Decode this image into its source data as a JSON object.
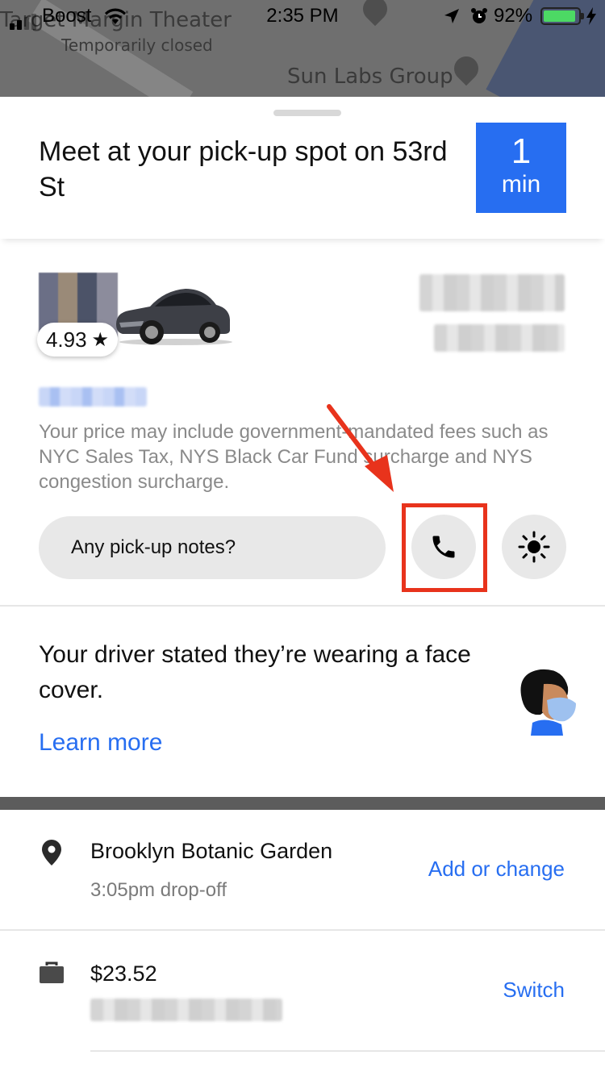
{
  "status_bar": {
    "carrier": "Boost",
    "time": "2:35 PM",
    "battery_percent": "92%",
    "battery_level": 0.92
  },
  "map": {
    "labels": [
      "Target Margin Theater",
      "Temporarily closed",
      "Sun Labs Group"
    ]
  },
  "trip_header": {
    "headline": "Meet at your pick-up spot on 53rd St",
    "eta_value": "1",
    "eta_unit": "min"
  },
  "driver": {
    "rating": "4.93"
  },
  "fees_notice": "Your price may include government-mandated fees such as NYC Sales Tax, NYS Black Car Fund surcharge and NYS congestion surcharge.",
  "actions": {
    "notes_placeholder": "Any pick-up notes?"
  },
  "safety": {
    "message": "Your driver stated they’re wearing a face cover.",
    "link": "Learn more"
  },
  "destination": {
    "name": "Brooklyn Botanic Garden",
    "dropoff": "3:05pm drop-off",
    "action": "Add or change"
  },
  "payment": {
    "price": "$23.52",
    "action": "Switch"
  },
  "colors": {
    "accent_blue": "#276ef1",
    "annotation_red": "#e8331c",
    "battery_green": "#4cd964"
  },
  "icons": [
    "location-arrow-icon",
    "alarm-icon",
    "phone-icon",
    "beacon-icon",
    "pin-icon",
    "briefcase-icon",
    "star-icon"
  ]
}
